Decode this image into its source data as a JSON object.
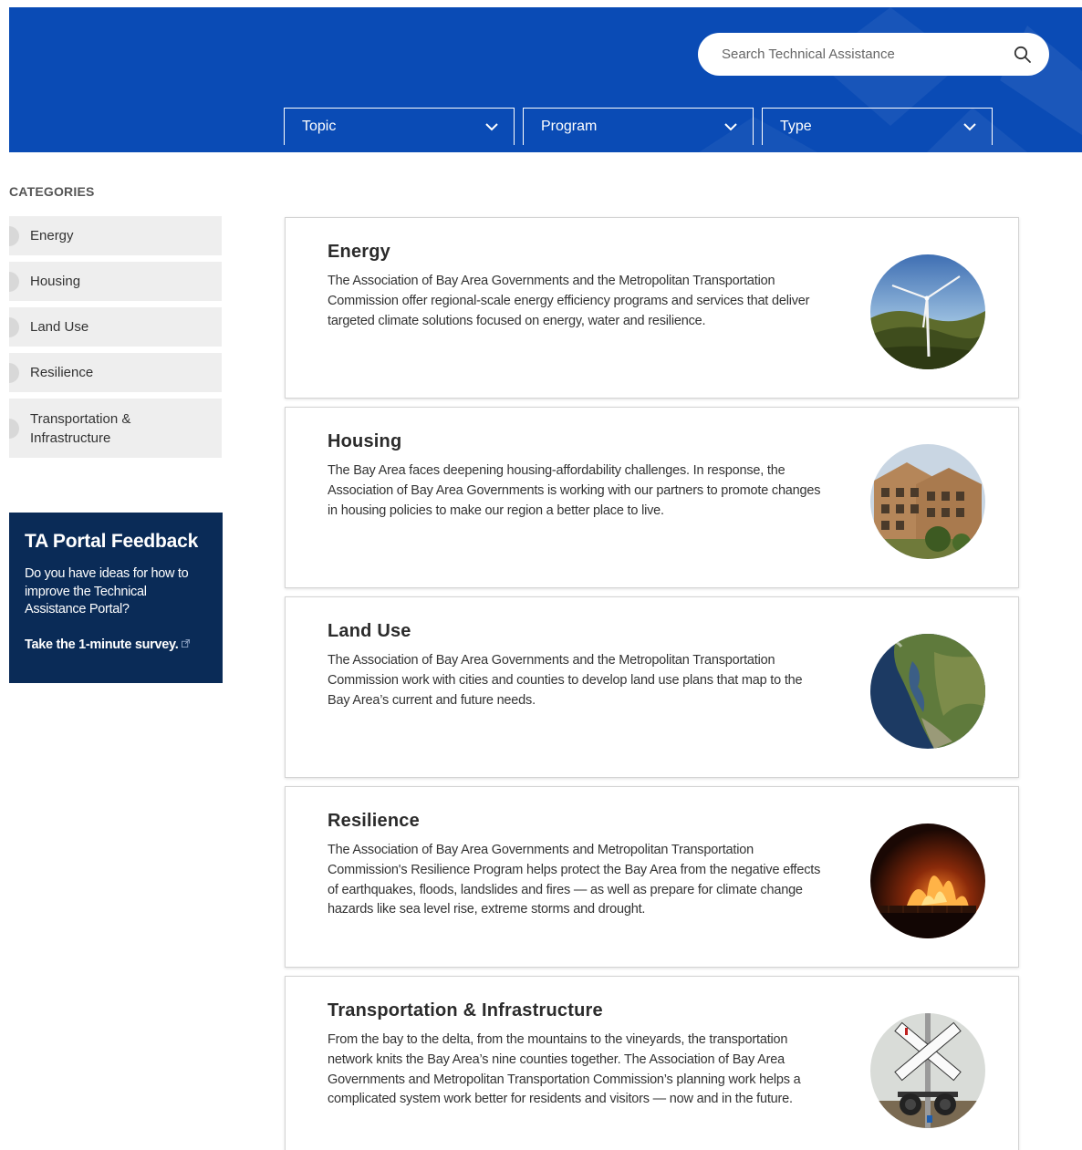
{
  "search": {
    "placeholder": "Search Technical Assistance",
    "icon": "search-icon"
  },
  "filters": [
    {
      "label": "Topic"
    },
    {
      "label": "Program"
    },
    {
      "label": "Type"
    }
  ],
  "sidebar": {
    "title": "CATEGORIES",
    "items": [
      {
        "label": "Energy"
      },
      {
        "label": "Housing"
      },
      {
        "label": "Land Use"
      },
      {
        "label": "Resilience"
      },
      {
        "label": "Transportation & Infrastructure"
      }
    ]
  },
  "feedback": {
    "title": "TA Portal Feedback",
    "body": "Do you have ideas for how to improve the Technical Assistance Portal?",
    "link": "Take the 1-minute survey."
  },
  "cards": [
    {
      "title": "Energy",
      "body": "The Association of Bay Area Governments and the Metropolitan Transportation Commission offer regional-scale energy efficiency programs and services that deliver targeted climate solutions focused on energy, water and resilience.",
      "image": "wind-turbine-photo"
    },
    {
      "title": "Housing",
      "body": "The Bay Area faces deepening housing-affordability challenges. In response, the Association of Bay Area Governments is working with our partners to promote changes in housing policies to make our region a better place to live.",
      "image": "apartment-building-photo"
    },
    {
      "title": "Land Use",
      "body": "The Association of Bay Area Governments and the Metropolitan Transportation Commission work with cities and counties to develop land use plans that map to the Bay Area’s current and future needs.",
      "image": "bay-area-satellite-photo"
    },
    {
      "title": "Resilience",
      "body": "The Association of Bay Area Governments and Metropolitan Transportation Commission's Resilience Program helps protect the Bay Area from the negative effects of earthquakes, floods, landslides and fires — as well as prepare for climate change hazards like sea level rise, extreme storms and drought.",
      "image": "wildfire-photo"
    },
    {
      "title": "Transportation & Infrastructure",
      "body": "From the bay to the delta, from the mountains to the vineyards, the transportation network knits the Bay Area’s nine counties together. The Association of Bay Area Governments and Metropolitan Transportation Commission’s planning work helps a complicated system work better for residents and visitors — now and in the future.",
      "image": "railroad-crossing-photo"
    }
  ],
  "colors": {
    "hero": "#0a4bb5",
    "feedback_bg": "#0a2b57",
    "sidebar_item_bg": "#eeeeee"
  }
}
